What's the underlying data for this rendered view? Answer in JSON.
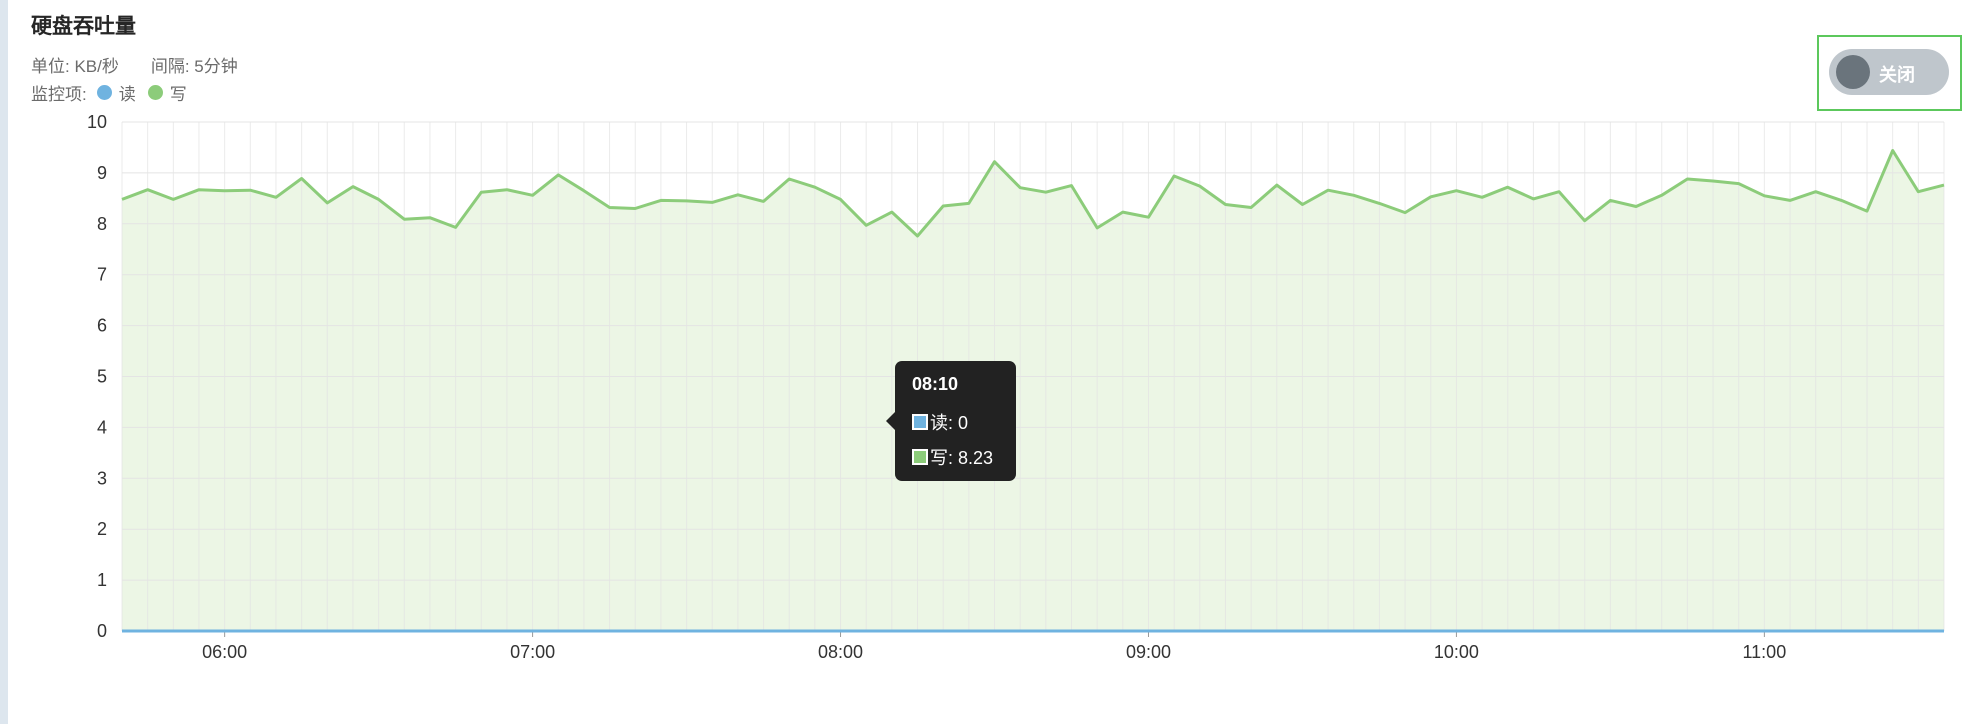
{
  "header": {
    "title": "硬盘吞吐量",
    "unit": "单位: KB/秒",
    "interval": "间隔: 5分钟",
    "monitor_label": "监控项:"
  },
  "toggle": {
    "label": "关闭",
    "state": "off"
  },
  "tooltip": {
    "time": "08:10",
    "rows": [
      {
        "label": "读: 0",
        "color": "#6fb3e0"
      },
      {
        "label": "写: 8.23",
        "color": "#8ccc7a"
      }
    ]
  },
  "colors": {
    "read": "#6fb3e0",
    "write": "#8ccc7a",
    "write_fill": "#ecf6e5"
  },
  "chart_data": {
    "type": "area",
    "x_ticks": [
      "06:00",
      "07:00",
      "08:00",
      "09:00",
      "10:00",
      "11:00"
    ],
    "x_range": [
      "05:40",
      "11:35"
    ],
    "interval_minutes": 5,
    "ylim": [
      0,
      10
    ],
    "y_ticks": [
      0,
      1,
      2,
      3,
      4,
      5,
      6,
      7,
      8,
      9,
      10
    ],
    "grid": true,
    "series": [
      {
        "name": "读",
        "color": "#6fb3e0",
        "values": [
          0,
          0,
          0,
          0,
          0,
          0,
          0,
          0,
          0,
          0,
          0,
          0,
          0,
          0,
          0,
          0,
          0,
          0,
          0,
          0,
          0,
          0,
          0,
          0,
          0,
          0,
          0,
          0,
          0,
          0,
          0,
          0,
          0,
          0,
          0,
          0,
          0,
          0,
          0,
          0,
          0,
          0,
          0,
          0,
          0,
          0,
          0,
          0,
          0,
          0,
          0,
          0,
          0,
          0,
          0,
          0,
          0,
          0,
          0,
          0,
          0,
          0,
          0,
          0,
          0,
          0,
          0,
          0,
          0,
          0,
          0,
          0
        ]
      },
      {
        "name": "写",
        "color": "#8ccc7a",
        "values": [
          8.48,
          8.67,
          8.48,
          8.67,
          8.65,
          8.66,
          8.52,
          8.89,
          8.41,
          8.73,
          8.48,
          8.09,
          8.12,
          7.93,
          8.62,
          8.67,
          8.56,
          8.96,
          8.65,
          8.32,
          8.3,
          8.46,
          8.45,
          8.42,
          8.57,
          8.44,
          8.88,
          8.72,
          8.48,
          7.97,
          8.23,
          7.76,
          8.35,
          8.4,
          9.22,
          8.71,
          8.62,
          8.75,
          7.92,
          8.23,
          8.13,
          8.94,
          8.74,
          8.38,
          8.32,
          8.76,
          8.38,
          8.66,
          8.56,
          8.4,
          8.22,
          8.53,
          8.65,
          8.52,
          8.72,
          8.49,
          8.63,
          8.06,
          8.46,
          8.34,
          8.56,
          8.88,
          8.84,
          8.79,
          8.55,
          8.46,
          8.63,
          8.46,
          8.25,
          9.44,
          8.63,
          8.76
        ]
      }
    ]
  }
}
